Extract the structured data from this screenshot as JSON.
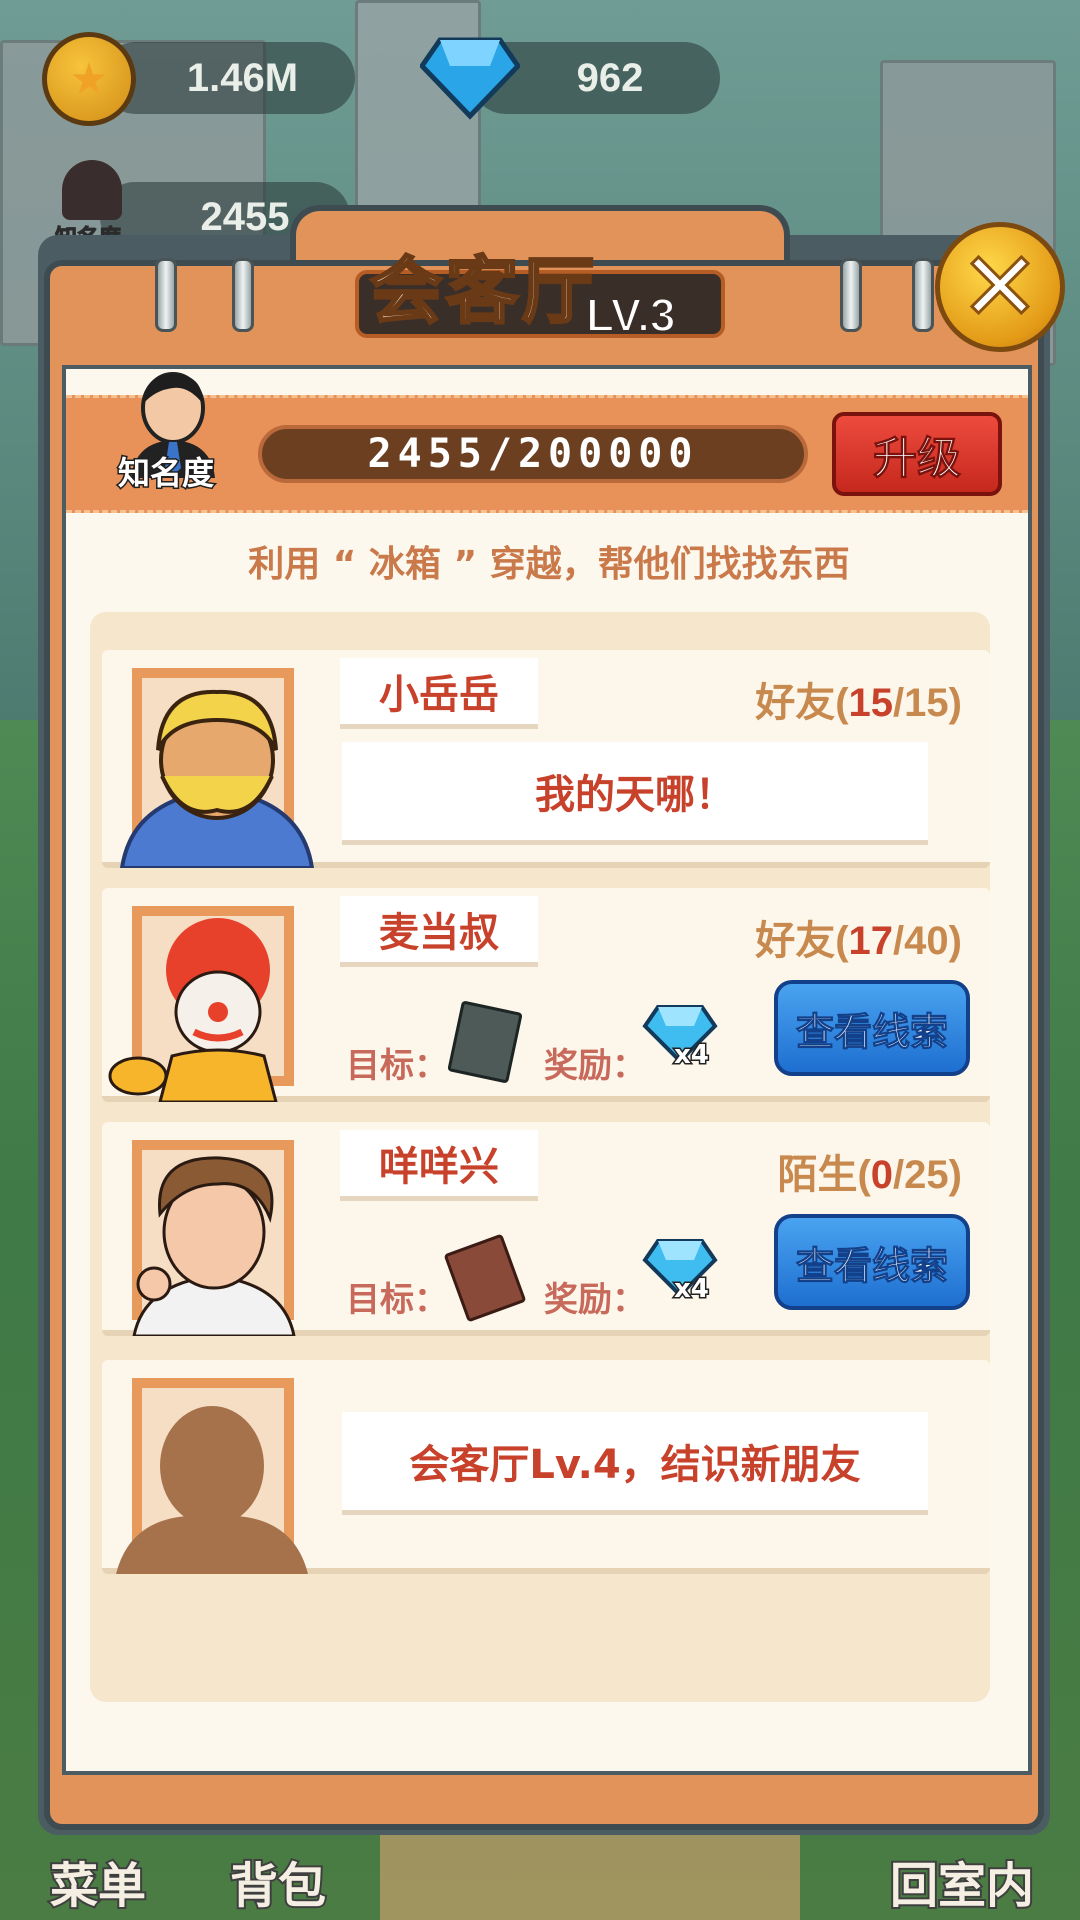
{
  "hud": {
    "coins": "1.46M",
    "gems": "962",
    "fame_value": "2455",
    "fame_label": "知名度"
  },
  "panel": {
    "title": "会客厅",
    "level": "LV.3",
    "fame_label": "知名度",
    "fame_progress": "2455/200000",
    "upgrade_label": "升级",
    "hint": "利用 “ 冰箱 ” 穿越，帮他们找找东西"
  },
  "characters": [
    {
      "name": "小岳岳",
      "status_word": "好友",
      "current": "15",
      "total": "15",
      "speech": "我的天哪！"
    },
    {
      "name": "麦当叔",
      "status_word": "好友",
      "current": "17",
      "total": "40",
      "target_label": "目标：",
      "reward_label": "奖励：",
      "reward_count": "x4",
      "clue_label": "查看线索"
    },
    {
      "name": "咩咩兴",
      "status_word": "陌生",
      "current": "0",
      "total": "25",
      "target_label": "目标：",
      "reward_label": "奖励：",
      "reward_count": "x4",
      "clue_label": "查看线索"
    },
    {
      "locked_message": "会客厅Lv.4，结识新朋友"
    }
  ],
  "bottom_nav": {
    "menu": "菜单",
    "bag": "背包",
    "return": "回室内"
  },
  "colors": {
    "panel_orange": "#e2935a",
    "name_red": "#c8412b",
    "clue_blue": "#1e6fd0",
    "upgrade_red": "#c5281d"
  }
}
